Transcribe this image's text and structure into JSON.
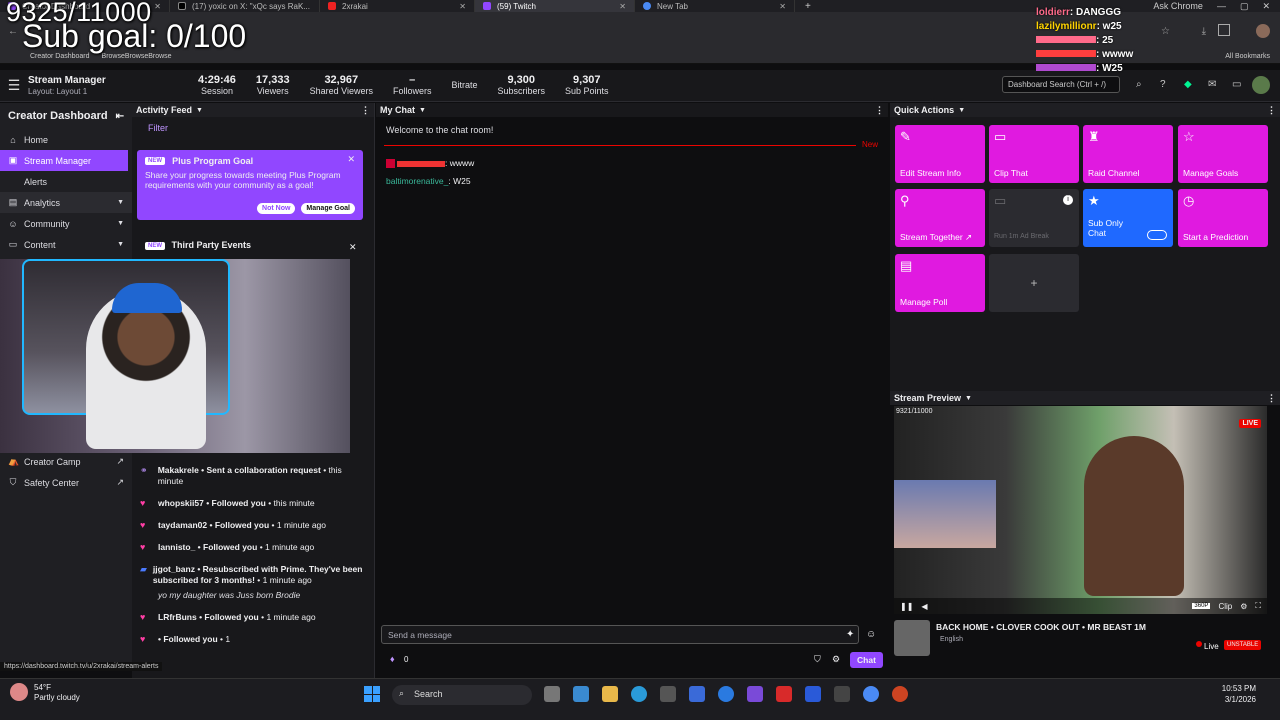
{
  "browser": {
    "tabs": [
      {
        "label": "Creator Dashboard",
        "active": false
      },
      {
        "label": "(17) yoxic on X: \"xQc says RaK...",
        "active": false
      },
      {
        "label": "2xrakai",
        "active": false
      },
      {
        "label": "(59) Twitch",
        "active": true
      },
      {
        "label": "New Tab",
        "active": false
      }
    ],
    "ask_chrome": "Ask Chrome",
    "bookmarks": [
      "Creator Dashboard",
      "BrowseBrowseBrowse"
    ],
    "all_bookmarks": "All Bookmarks",
    "status_url": "https://dashboard.twitch.tv/u/2xrakai/stream-alerts"
  },
  "overlay": {
    "sub_count": "9325/11000",
    "sub_goal": "Sub goal: 0/100",
    "chat": [
      {
        "name": "loldierr",
        "msg": ": DANGGG"
      },
      {
        "name": "lazilymillionr",
        "msg": ": w25"
      },
      {
        "name": "",
        "msg": ": 25"
      },
      {
        "name": "",
        "msg": ": wwww"
      },
      {
        "name": "",
        "msg": ": W25"
      }
    ]
  },
  "stats": {
    "title": "Stream Manager",
    "layout": "Layout: Layout 1",
    "items": [
      {
        "value": "4:29:46",
        "label": "Session"
      },
      {
        "value": "17,333",
        "label": "Viewers"
      },
      {
        "value": "32,967",
        "label": "Shared Viewers"
      },
      {
        "value": "–",
        "label": "Followers"
      },
      {
        "value": "",
        "label": "Bitrate"
      },
      {
        "value": "9,300",
        "label": "Subscribers"
      },
      {
        "value": "9,307",
        "label": "Sub Points"
      }
    ],
    "search_placeholder": "Dashboard Search (Ctrl + /)"
  },
  "nav": {
    "heading": "Creator Dashboard",
    "items": [
      {
        "label": "Home",
        "icon": "home-icon"
      },
      {
        "label": "Stream Manager",
        "icon": "broadcast-icon",
        "active": true
      },
      {
        "label": "Alerts",
        "icon": "alert-icon"
      },
      {
        "label": "Analytics",
        "icon": "chart-icon",
        "chevron": true
      },
      {
        "label": "Community",
        "icon": "people-icon",
        "chevron": true
      },
      {
        "label": "Content",
        "icon": "content-icon",
        "chevron": true
      }
    ],
    "bottom": [
      {
        "label": "Creator Camp"
      },
      {
        "label": "Safety Center"
      }
    ]
  },
  "activity": {
    "title": "Activity Feed",
    "filter": "Filter",
    "goal_card": {
      "badge": "NEW",
      "title": "Plus Program Goal",
      "text": "Share your progress towards meeting Plus Program requirements with your community as a goal!",
      "not_now": "Not Now",
      "manage": "Manage Goal"
    },
    "third_party": {
      "badge": "NEW",
      "title": "Third Party Events"
    },
    "feed": [
      {
        "user": "Makakrele",
        "text": " • Sent a collaboration request",
        "time": " • this minute"
      },
      {
        "user": "whopskii57",
        "text": " • Followed you",
        "time": " • this minute"
      },
      {
        "user": "taydaman02",
        "text": " • Followed you",
        "time": " • 1 minute ago"
      },
      {
        "user": "lannisto_",
        "text": " • Followed you",
        "time": " • 1 minute ago"
      },
      {
        "user": "jjgot_banz",
        "text": " • Resubscribed with Prime. They've been subscribed for 3 months!",
        "time": " • 1 minute ago"
      },
      {
        "user": "",
        "text": "yo my daughter was Juss born Brodie",
        "time": ""
      },
      {
        "user": "LRfrBuns",
        "text": " • Followed you",
        "time": " • 1 minute ago"
      },
      {
        "user": "",
        "text": " • Followed you",
        "time": " • 1"
      }
    ]
  },
  "chat": {
    "title": "My Chat",
    "welcome": "Welcome to the chat room!",
    "new_label": "New",
    "messages": [
      {
        "user": "",
        "text": ": wwww"
      },
      {
        "user": "baltimorenative_",
        "text": ": W25"
      }
    ],
    "input_placeholder": "Send a message",
    "points": "0",
    "chat_button": "Chat"
  },
  "quick_actions": {
    "title": "Quick Actions",
    "tiles": [
      {
        "label": "Edit Stream Info",
        "icon": "pencil-icon",
        "style": "pink"
      },
      {
        "label": "Clip That",
        "icon": "clip-icon",
        "style": "pink"
      },
      {
        "label": "Raid Channel",
        "icon": "raid-icon",
        "style": "pink"
      },
      {
        "label": "Manage Goals",
        "icon": "star-icon",
        "style": "pink"
      },
      {
        "label": "Stream Together ↗",
        "icon": "add-person-icon",
        "style": "pink"
      },
      {
        "label": "Run 1m Ad Break",
        "icon": "ad-icon",
        "style": "gray"
      },
      {
        "label": "Sub Only Chat",
        "icon": "star-icon",
        "style": "blue"
      },
      {
        "label": "Start a Prediction",
        "icon": "prediction-icon",
        "style": "pink"
      },
      {
        "label": "Manage Poll",
        "icon": "poll-icon",
        "style": "pink"
      },
      {
        "label": "+",
        "icon": "plus-icon",
        "style": "gray"
      }
    ]
  },
  "preview": {
    "title": "Stream Preview",
    "overlay_count": "9321/11000",
    "live": "LIVE",
    "quality": "360P",
    "clip": "Clip",
    "stream_title": "BACK HOME • CLOVER COOK OUT • MR BEAST 1M",
    "language": "English",
    "live_label": "Live",
    "unstable": "UNSTABLE"
  },
  "taskbar": {
    "temp": "54°F",
    "weather": "Partly cloudy",
    "search": "Search",
    "time": "10:53 PM",
    "date": "3/1/2026"
  }
}
